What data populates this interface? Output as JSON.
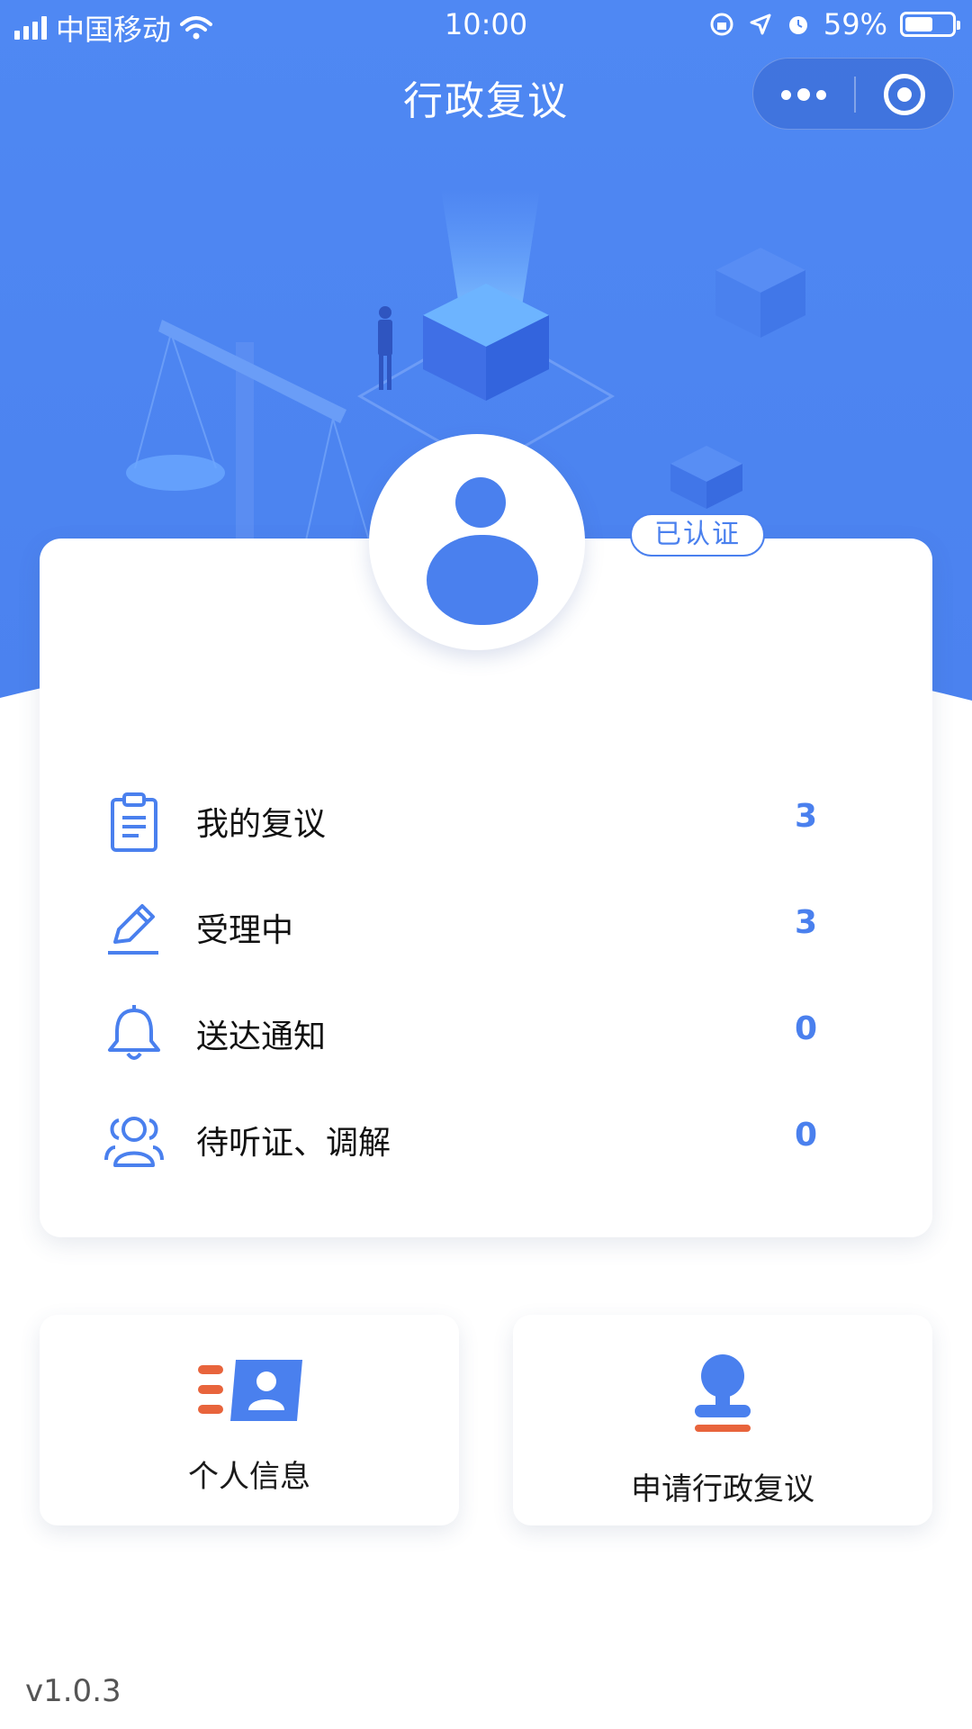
{
  "status_bar": {
    "carrier": "中国移动",
    "time": "10:00",
    "battery": "59%",
    "battery_level": 0.59
  },
  "nav": {
    "title": "行政复议"
  },
  "profile": {
    "verified_label": "已认证"
  },
  "menu": {
    "items": [
      {
        "label": "我的复议",
        "count": "3",
        "icon": "clipboard-icon"
      },
      {
        "label": "受理中",
        "count": "3",
        "icon": "pencil-icon"
      },
      {
        "label": "送达通知",
        "count": "0",
        "icon": "bell-icon"
      },
      {
        "label": "待听证、调解",
        "count": "0",
        "icon": "people-icon"
      }
    ]
  },
  "tiles": {
    "personal_info": {
      "label": "个人信息",
      "icon": "id-card-icon"
    },
    "apply": {
      "label": "申请行政复议",
      "icon": "stamp-icon"
    }
  },
  "footer": {
    "version": "v1.0.3"
  },
  "colors": {
    "primary": "#4a80ee",
    "accent_orange": "#e8643c",
    "header_bg": "#4e87f2"
  }
}
